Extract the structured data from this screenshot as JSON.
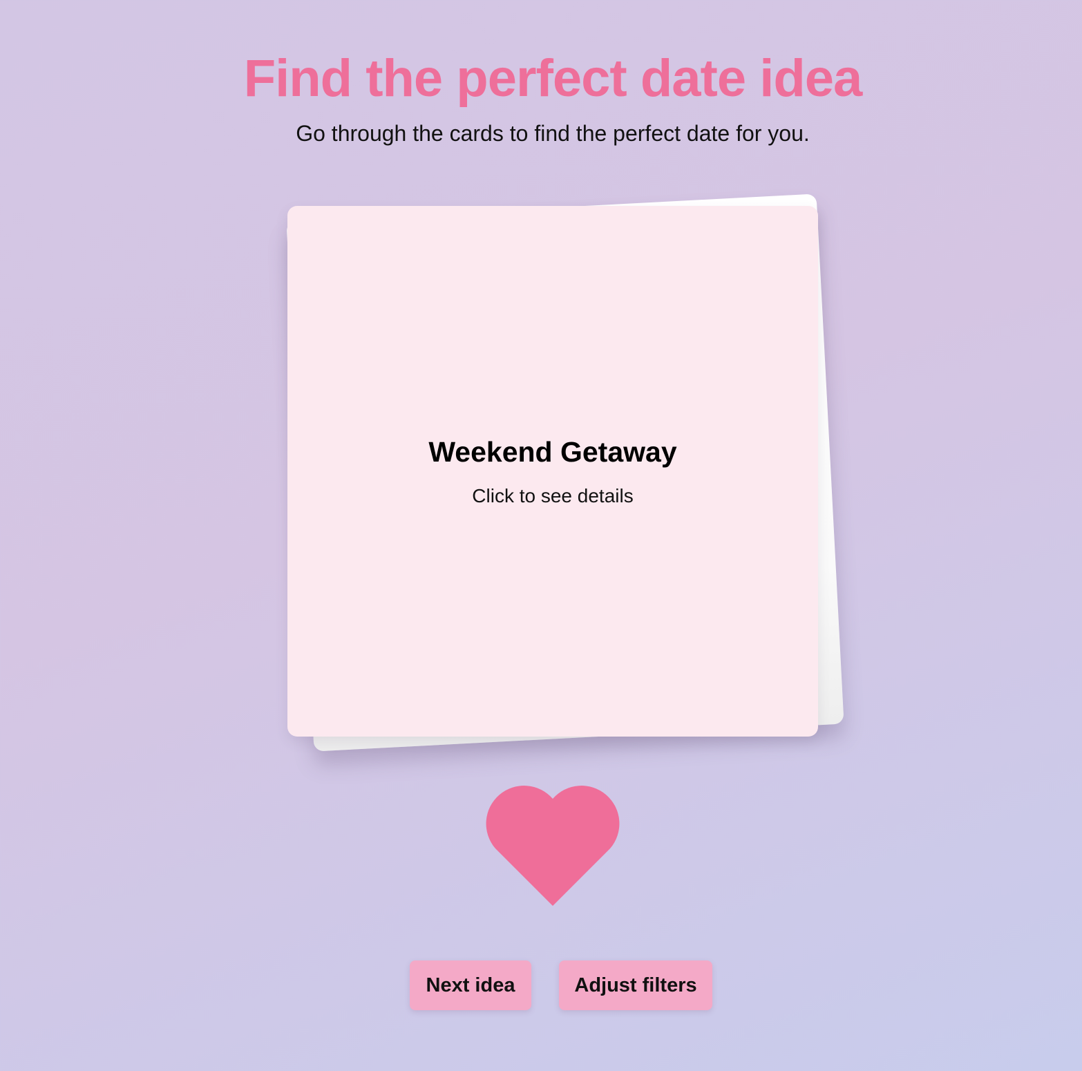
{
  "header": {
    "title": "Find the perfect date idea",
    "subtitle": "Go through the cards to find the perfect date for you."
  },
  "card": {
    "title": "Weekend Getaway",
    "hint": "Click to see details",
    "background_color": "#fce9ef"
  },
  "like": {
    "icon": "heart-icon",
    "color": "#ef6e99"
  },
  "actions": {
    "next_label": "Next idea",
    "filters_label": "Adjust filters",
    "button_color": "#f4a9c7"
  },
  "colors": {
    "accent": "#ee6f9a"
  }
}
